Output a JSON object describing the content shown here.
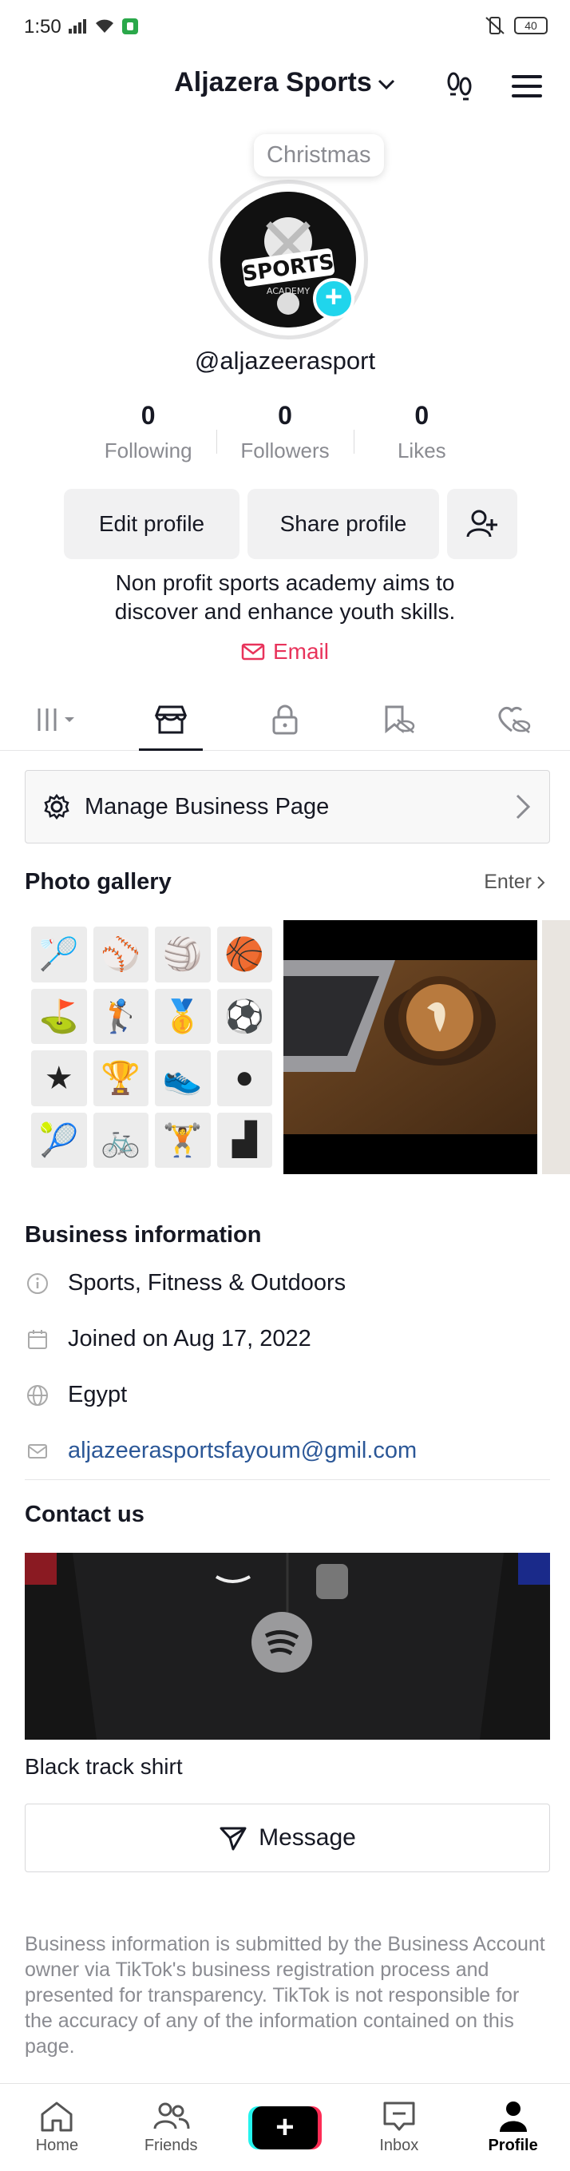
{
  "status_bar": {
    "time": "1:50",
    "battery": "40"
  },
  "header": {
    "title": "Aljazera Sports",
    "dropdown_icon": "chevron-down-icon",
    "right_icons": [
      "footprints-icon",
      "hamburger-menu-icon"
    ]
  },
  "profile": {
    "avatar_bubble": "Christmas",
    "avatar_logo_text": "SPORTS",
    "avatar_logo_subtext": "ACADEMY",
    "username": "@aljazeerasport",
    "stats": [
      {
        "value": "0",
        "label": "Following"
      },
      {
        "value": "0",
        "label": "Followers"
      },
      {
        "value": "0",
        "label": "Likes"
      }
    ],
    "edit_profile_label": "Edit profile",
    "share_profile_label": "Share profile",
    "bio": "Non profit sports academy aims to discover and enhance youth skills.",
    "email_label": "Email"
  },
  "tabs": [
    {
      "icon": "grid-dropdown-icon",
      "active": false
    },
    {
      "icon": "shop-icon",
      "active": true
    },
    {
      "icon": "lock-icon",
      "active": false
    },
    {
      "icon": "hidden-tag-icon",
      "active": false
    },
    {
      "icon": "hidden-heart-icon",
      "active": false
    }
  ],
  "business": {
    "manage_label": "Manage Business Page",
    "gallery_title": "Photo gallery",
    "gallery_enter": "Enter",
    "info_title": "Business information",
    "category": "Sports, Fitness & Outdoors",
    "joined": "Joined on Aug 17, 2022",
    "location": "Egypt",
    "email": "aljazeerasportsfayoum@gmil.com",
    "contact_title": "Contact us",
    "product_name": "Black track shirt",
    "message_label": "Message",
    "disclaimer": "Business information is submitted by the Business Account owner via TikTok's business registration process and presented for transparency. TikTok is not responsible for the accuracy of any of the information contained on this page."
  },
  "bottom_nav": [
    {
      "label": "Home",
      "icon": "home-icon"
    },
    {
      "label": "Friends",
      "icon": "friends-icon"
    },
    {
      "label": "",
      "icon": "create-plus-icon"
    },
    {
      "label": "Inbox",
      "icon": "inbox-icon"
    },
    {
      "label": "Profile",
      "icon": "profile-icon",
      "active": true
    }
  ],
  "colors": {
    "accent_red": "#e8335b",
    "link_blue": "#2b5797",
    "badge_cyan": "#20d5ec"
  }
}
